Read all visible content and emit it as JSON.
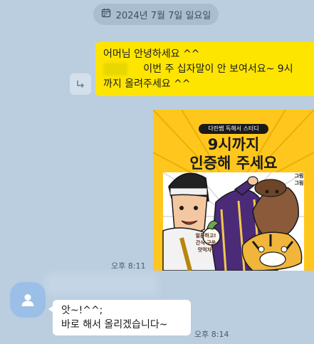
{
  "date_divider": {
    "icon": "calendar-icon",
    "label": "2024년 7월 7일 일요일"
  },
  "outgoing": {
    "message": {
      "line1": "어머님 안녕하세요 ^^",
      "line2": "이번 주 십자말이 안 보여서요~ 9시",
      "line3": "까지 올려주세요 ^^"
    },
    "share_icon": "share-icon",
    "image": {
      "badge": "다린쌤 독해서 스터디",
      "title_line1": "9시까지",
      "title_line2": "인증해 주세요",
      "note_right": "그림\n그림",
      "note_left": "얼른하고!\n간식 구운\n맛먹자!"
    },
    "time": "오후 8:11"
  },
  "incoming": {
    "avatar_icon": "person-icon",
    "message": {
      "line1": "앗~!^^;",
      "line2": "바로 해서 올리겠습니다~"
    },
    "time": "오후 8:14"
  },
  "colors": {
    "background": "#bacee0",
    "my_bubble": "#fee500",
    "their_bubble": "#ffffff",
    "avatar": "#9bbfe6"
  }
}
